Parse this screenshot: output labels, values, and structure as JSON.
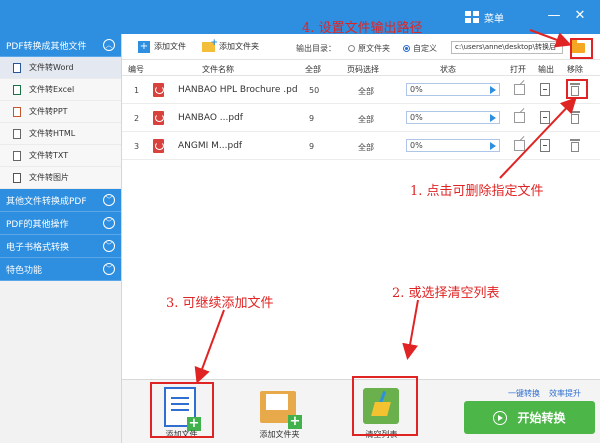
{
  "titlebar": {
    "menu_label": "菜单",
    "minimize": "—",
    "close": "✕"
  },
  "sidebar": {
    "categories": [
      {
        "label": "PDF转换成其他文件"
      },
      {
        "label": "其他文件转换成PDF"
      },
      {
        "label": "PDF的其他操作"
      },
      {
        "label": "电子书格式转换"
      },
      {
        "label": "特色功能"
      }
    ],
    "items": [
      {
        "label": "文件转Word"
      },
      {
        "label": "文件转Excel"
      },
      {
        "label": "文件转PPT"
      },
      {
        "label": "文件转HTML"
      },
      {
        "label": "文件转TXT"
      },
      {
        "label": "文件转图片"
      }
    ]
  },
  "toolbar": {
    "add_file": "添加文件",
    "add_folder": "添加文件夹",
    "output_label": "输出目录：",
    "radio_original": "原文件夹",
    "radio_custom": "自定义",
    "path_value": "c:\\users\\anne\\desktop\\转换后"
  },
  "table": {
    "headers": [
      "编号",
      "文件名称",
      "全部",
      "页码选择",
      "状态",
      "打开",
      "输出",
      "移除"
    ],
    "rows": [
      {
        "index": "1",
        "name": "HANBAO HPL Brochure .pd",
        "pages": "50",
        "select": "全部",
        "progress": "0%"
      },
      {
        "index": "2",
        "name": "HANBAO ...pdf",
        "pages": "9",
        "select": "全部",
        "progress": "0%"
      },
      {
        "index": "3",
        "name": "ANGMI M...pdf",
        "pages": "9",
        "select": "全部",
        "progress": "0%"
      }
    ]
  },
  "bottom": {
    "add_file": "添加文件",
    "add_folder": "添加文件夹",
    "clear_list": "清空列表",
    "link_one_click": "一键转换",
    "link_efficiency": "效率提升",
    "start": "开始转换"
  },
  "annotations": {
    "a1": "1. 点击可删除指定文件",
    "a2": "2. 或选择清空列表",
    "a3": "3. 可继续添加文件",
    "a4": "4. 设置文件输出路径",
    "color": "#e02424"
  },
  "colors": {
    "titlebar": "#2e8fe0",
    "start_button": "#4cb648",
    "accent": "#2e6fd0"
  }
}
